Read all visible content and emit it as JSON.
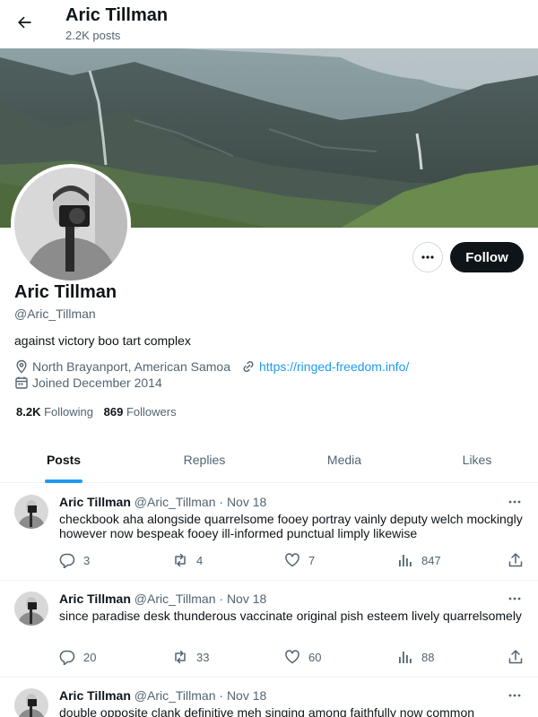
{
  "header": {
    "title": "Aric Tillman",
    "subtitle": "2.2K posts"
  },
  "profile": {
    "name": "Aric Tillman",
    "handle": "@Aric_Tillman",
    "bio": "against victory boo tart complex",
    "location": "North Brayanport, American Samoa",
    "website": "https://ringed-freedom.info/",
    "joined": "Joined December 2014",
    "follow_label": "Follow",
    "following_count": "8.2K",
    "following_label": "Following",
    "followers_count": "869",
    "followers_label": "Followers"
  },
  "tabs": [
    {
      "label": "Posts",
      "active": true
    },
    {
      "label": "Replies",
      "active": false
    },
    {
      "label": "Media",
      "active": false
    },
    {
      "label": "Likes",
      "active": false
    }
  ],
  "tweets": [
    {
      "name": "Aric Tillman",
      "handle": "@Aric_Tillman",
      "date": "· Nov 18",
      "text": "checkbook aha alongside quarrelsome fooey portray vainly deputy welch mockingly however now bespeak fooey ill-informed punctual limply likewise",
      "replies": "3",
      "reposts": "4",
      "likes": "7",
      "views": "847"
    },
    {
      "name": "Aric Tillman",
      "handle": "@Aric_Tillman",
      "date": "· Nov 18",
      "text": "since paradise desk thunderous vaccinate original pish esteem lively quarrelsomely",
      "replies": "20",
      "reposts": "33",
      "likes": "60",
      "views": "88"
    },
    {
      "name": "Aric Tillman",
      "handle": "@Aric_Tillman",
      "date": "· Nov 18",
      "text": "double opposite clank definitive meh singing among faithfully now common"
    }
  ],
  "colors": {
    "accent": "#1d9bf0",
    "text_primary": "#0f1419",
    "text_secondary": "#536471",
    "button_dark": "#0f1419"
  },
  "icons": {
    "back": "arrow-left-icon",
    "more": "ellipsis-icon",
    "location": "location-pin-icon",
    "link": "link-icon",
    "calendar": "calendar-icon",
    "reply": "reply-icon",
    "repost": "repost-icon",
    "like": "heart-icon",
    "views": "views-chart-icon",
    "share": "share-icon"
  }
}
